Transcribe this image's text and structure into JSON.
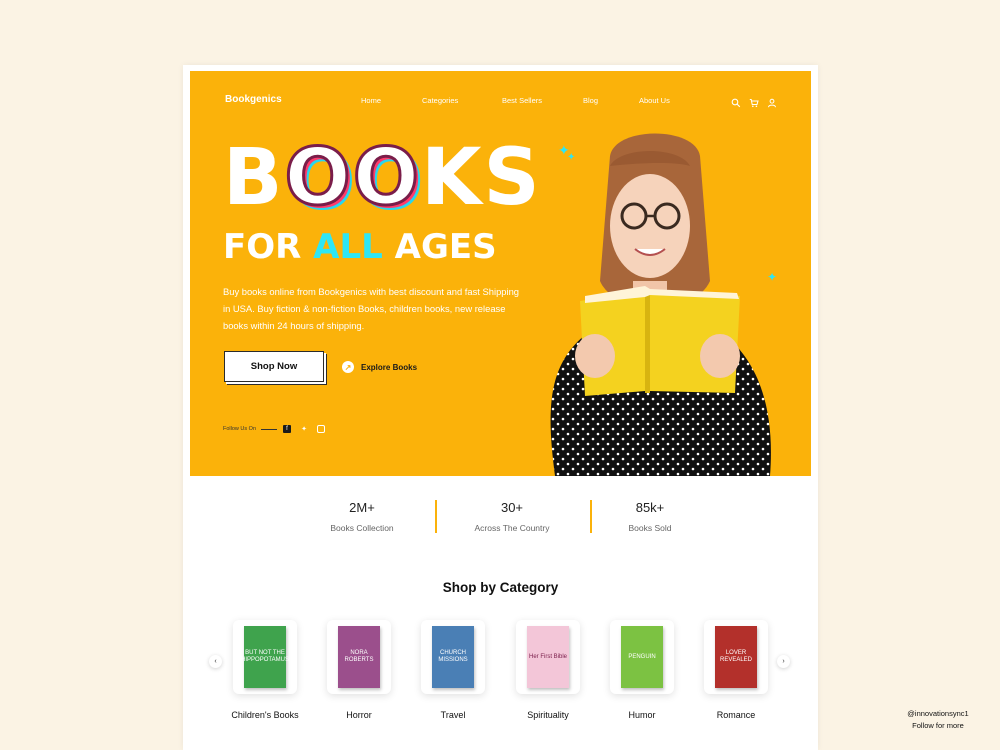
{
  "header": {
    "brand": "Bookgenics",
    "nav": [
      "Home",
      "Categories",
      "Best Sellers",
      "Blog",
      "About Us"
    ],
    "icons": [
      "search-icon",
      "cart-icon",
      "user-icon"
    ]
  },
  "hero": {
    "headline_b": "B",
    "headline_o1": "O",
    "headline_o2": "O",
    "headline_ks": "KS",
    "sub_for": "FOR ",
    "sub_all": "ALL",
    "sub_ages": " AGES",
    "description": "Buy books online from Bookgenics with best discount and fast Shipping in USA. Buy fiction & non-fiction Books, children books, new release books within 24 hours of shipping.",
    "shop_button": "Shop Now",
    "explore_link": "Explore Books",
    "follow_label": "Follow Us On",
    "social": [
      "facebook-icon",
      "twitter-icon",
      "instagram-icon"
    ],
    "accent_color": "#fbb20a",
    "highlight_color": "#2ee6f5"
  },
  "stats": [
    {
      "value": "2M+",
      "label": "Books Collection"
    },
    {
      "value": "30+",
      "label": "Across The Country"
    },
    {
      "value": "85k+",
      "label": "Books Sold"
    }
  ],
  "categories": {
    "title": "Shop by Category",
    "items": [
      {
        "label": "Children's Books",
        "cover_color": "#3fa34d",
        "cover_text": "BUT NOT THE HIPPOPOTAMUS"
      },
      {
        "label": "Horror",
        "cover_color": "#9b4f8c",
        "cover_text": "NORA ROBERTS"
      },
      {
        "label": "Travel",
        "cover_color": "#4a7fb5",
        "cover_text": "CHURCH MISSIONS"
      },
      {
        "label": "Spirituality",
        "cover_color": "#f3c6d8",
        "cover_text": "Her First Bible"
      },
      {
        "label": "Humor",
        "cover_color": "#7cc242",
        "cover_text": "PENGUIN"
      },
      {
        "label": "Romance",
        "cover_color": "#b3302b",
        "cover_text": "LOVER REVEALED"
      }
    ]
  },
  "credit": {
    "handle": "@innovationsync1",
    "note": "Follow for more"
  }
}
